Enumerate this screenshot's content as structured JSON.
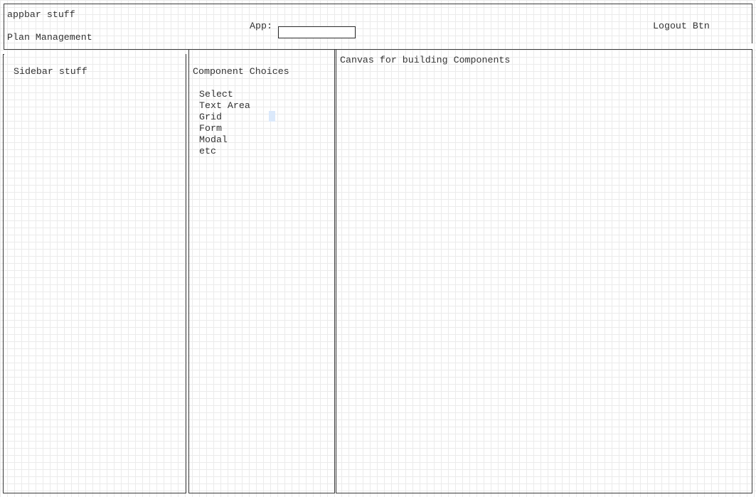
{
  "appbar": {
    "text": "appbar stuff",
    "title": "Plan Management",
    "app_label": "App:",
    "app_value": "",
    "logout_label": "Logout Btn"
  },
  "sidebar": {
    "label": "Sidebar stuff"
  },
  "components_panel": {
    "title": "Component Choices",
    "items": [
      {
        "label": "Select"
      },
      {
        "label": "Text Area"
      },
      {
        "label": "Grid"
      },
      {
        "label": "Form"
      },
      {
        "label": "Modal"
      },
      {
        "label": "etc"
      }
    ]
  },
  "canvas": {
    "label": "Canvas for building Components"
  }
}
